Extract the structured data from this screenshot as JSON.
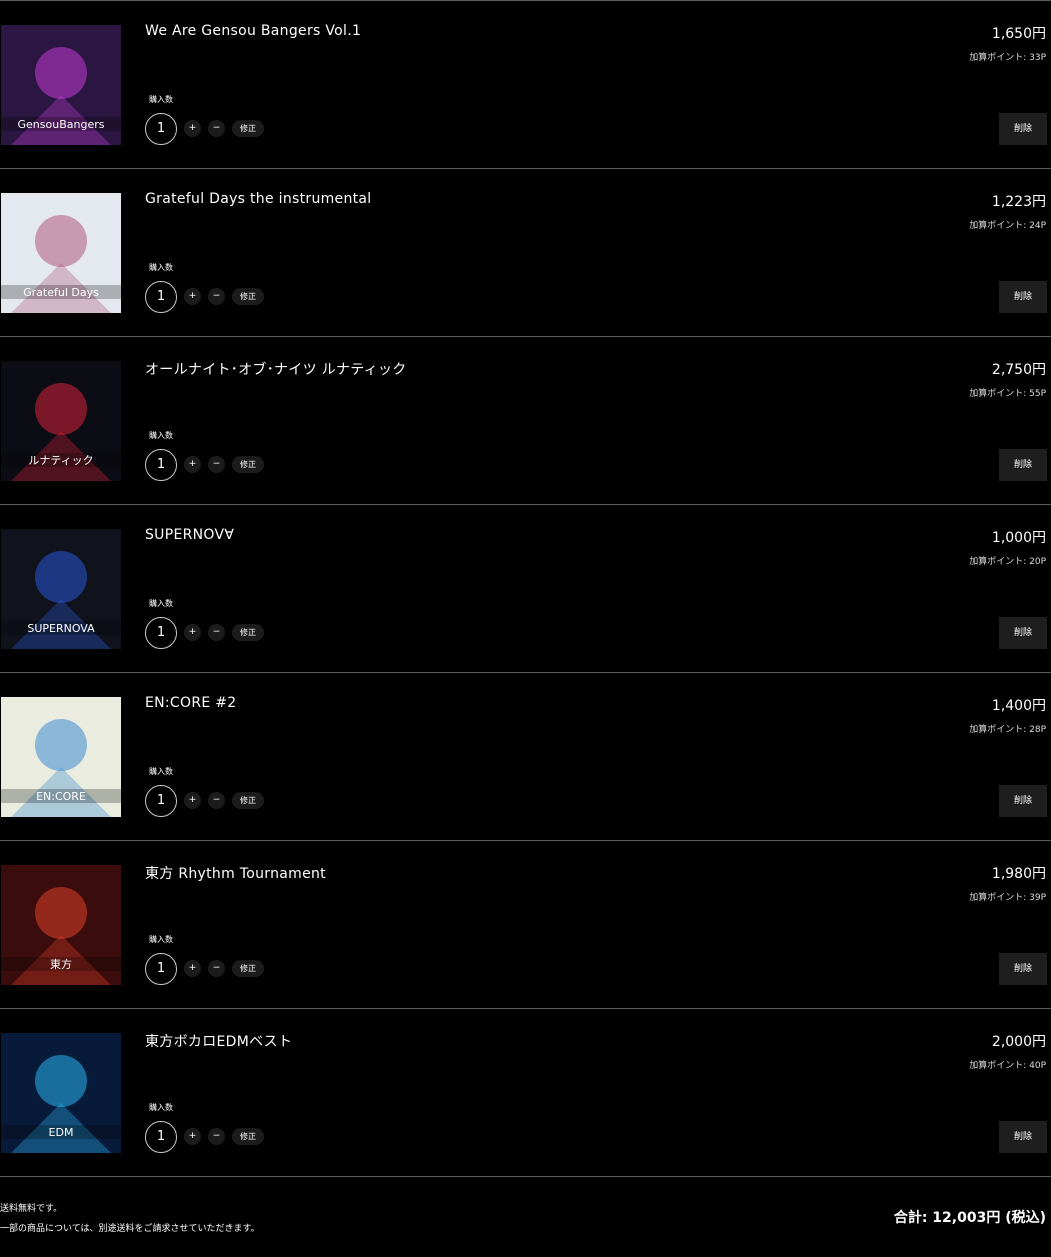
{
  "items": [
    {
      "title": "We Are Gensou Bangers Vol.1",
      "price": "1,650円",
      "points": "加算ポイント: 33P",
      "qty_label": "購入数",
      "qty": "1",
      "plus": "+",
      "minus": "−",
      "update": "修正",
      "delete": "削除",
      "cover_text": "GensouBangers",
      "cover_bg": "#2a1640",
      "cover_accent": "#c23dd6"
    },
    {
      "title": "Grateful Days the instrumental",
      "price": "1,223円",
      "points": "加算ポイント: 24P",
      "qty_label": "購入数",
      "qty": "1",
      "plus": "+",
      "minus": "−",
      "update": "修正",
      "delete": "削除",
      "cover_text": "Grateful Days",
      "cover_bg": "#e4e9ef",
      "cover_accent": "#b05a7a"
    },
    {
      "title": "オールナイト･オブ･ナイツ ルナティック",
      "price": "2,750円",
      "points": "加算ポイント: 55P",
      "qty_label": "購入数",
      "qty": "1",
      "plus": "+",
      "minus": "−",
      "update": "修正",
      "delete": "削除",
      "cover_text": "ルナティック",
      "cover_bg": "#0c0c14",
      "cover_accent": "#d6223a"
    },
    {
      "title": "SUPERNOV∀",
      "price": "1,000円",
      "points": "加算ポイント: 20P",
      "qty_label": "購入数",
      "qty": "1",
      "plus": "+",
      "minus": "−",
      "update": "修正",
      "delete": "削除",
      "cover_text": "SUPERNOVA",
      "cover_bg": "#10131c",
      "cover_accent": "#2a55d8"
    },
    {
      "title": "EN:CORE #2",
      "price": "1,400円",
      "points": "加算ポイント: 28P",
      "qty_label": "購入数",
      "qty": "1",
      "plus": "+",
      "minus": "−",
      "update": "修正",
      "delete": "削除",
      "cover_text": "EN:CORE",
      "cover_bg": "#e9ecdf",
      "cover_accent": "#3c8ad0"
    },
    {
      "title": "東方 Rhythm Tournament",
      "price": "1,980円",
      "points": "加算ポイント: 39P",
      "qty_label": "購入数",
      "qty": "1",
      "plus": "+",
      "minus": "−",
      "update": "修正",
      "delete": "削除",
      "cover_text": "東方",
      "cover_bg": "#3a0c0c",
      "cover_accent": "#e0402a"
    },
    {
      "title": "東方ボカロEDMベスト",
      "price": "2,000円",
      "points": "加算ポイント: 40P",
      "qty_label": "購入数",
      "qty": "1",
      "plus": "+",
      "minus": "−",
      "update": "修正",
      "delete": "削除",
      "cover_text": "EDM",
      "cover_bg": "#081a3a",
      "cover_accent": "#2ab4f0"
    }
  ],
  "footer": {
    "note1": "送料無料です。",
    "note2": "一部の商品については、別途送料をご請求させていただきます。",
    "total": "合計: 12,003円 (税込)"
  }
}
